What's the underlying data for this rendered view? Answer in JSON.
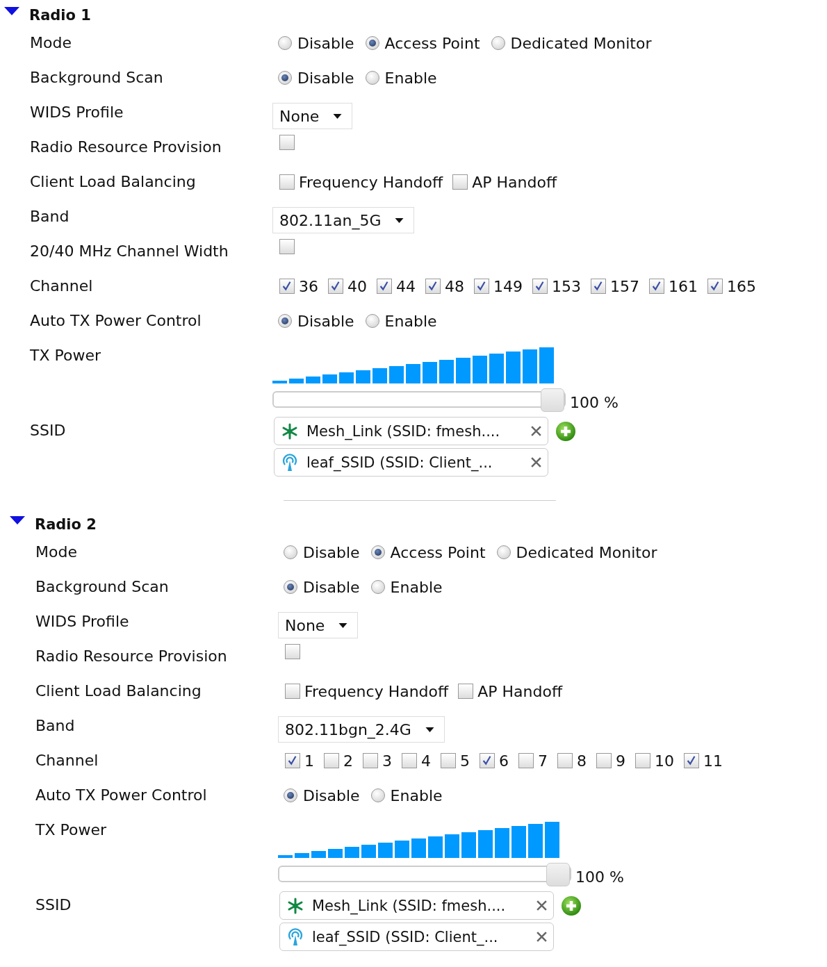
{
  "radios": [
    {
      "title": "Radio 1",
      "expanded": true,
      "rows": [
        {
          "kind": "radio",
          "label": "Mode",
          "options": [
            {
              "label": "Disable",
              "selected": false
            },
            {
              "label": "Access Point",
              "selected": true
            },
            {
              "label": "Dedicated Monitor",
              "selected": false
            }
          ]
        },
        {
          "kind": "radio",
          "label": "Background Scan",
          "options": [
            {
              "label": "Disable",
              "selected": true
            },
            {
              "label": "Enable",
              "selected": false
            }
          ]
        },
        {
          "kind": "select",
          "label": "WIDS Profile",
          "value": "None"
        },
        {
          "kind": "checkbox",
          "label": "Radio Resource Provision",
          "checked": false
        },
        {
          "kind": "checks",
          "label": "Client Load Balancing",
          "options": [
            {
              "label": "Frequency Handoff",
              "checked": false
            },
            {
              "label": "AP Handoff",
              "checked": false
            }
          ]
        },
        {
          "kind": "select",
          "label": "Band",
          "value": "802.11an_5G"
        },
        {
          "kind": "checkbox",
          "label": "20/40 MHz Channel Width",
          "checked": false
        },
        {
          "kind": "checks",
          "label": "Channel",
          "options": [
            {
              "label": "36",
              "checked": true
            },
            {
              "label": "40",
              "checked": true
            },
            {
              "label": "44",
              "checked": true
            },
            {
              "label": "48",
              "checked": true
            },
            {
              "label": "149",
              "checked": true
            },
            {
              "label": "153",
              "checked": true
            },
            {
              "label": "157",
              "checked": true
            },
            {
              "label": "161",
              "checked": true
            },
            {
              "label": "165",
              "checked": true
            }
          ]
        },
        {
          "kind": "radio",
          "label": "Auto TX Power Control",
          "options": [
            {
              "label": "Disable",
              "selected": true
            },
            {
              "label": "Enable",
              "selected": false
            }
          ]
        },
        {
          "kind": "power",
          "label": "TX Power",
          "level": 1,
          "reading": "100 %"
        },
        {
          "kind": "ssid",
          "label": "SSID",
          "items": [
            {
              "kind": "mesh",
              "label": "Mesh_Link (SSID: fmesh...."
            },
            {
              "kind": "leaf",
              "label": "leaf_SSID (SSID: Client_..."
            }
          ]
        }
      ]
    },
    {
      "title": "Radio 2",
      "expanded": true,
      "rows": [
        {
          "kind": "radio",
          "label": "Mode",
          "options": [
            {
              "label": "Disable",
              "selected": false
            },
            {
              "label": "Access Point",
              "selected": true
            },
            {
              "label": "Dedicated Monitor",
              "selected": false
            }
          ]
        },
        {
          "kind": "radio",
          "label": "Background Scan",
          "options": [
            {
              "label": "Disable",
              "selected": true
            },
            {
              "label": "Enable",
              "selected": false
            }
          ]
        },
        {
          "kind": "select",
          "label": "WIDS Profile",
          "value": "None"
        },
        {
          "kind": "checkbox",
          "label": "Radio Resource Provision",
          "checked": false
        },
        {
          "kind": "checks",
          "label": "Client Load Balancing",
          "options": [
            {
              "label": "Frequency Handoff",
              "checked": false
            },
            {
              "label": "AP Handoff",
              "checked": false
            }
          ]
        },
        {
          "kind": "select",
          "label": "Band",
          "value": "802.11bgn_2.4G"
        },
        {
          "kind": "checks",
          "label": "Channel",
          "options": [
            {
              "label": "1",
              "checked": true
            },
            {
              "label": "2",
              "checked": false
            },
            {
              "label": "3",
              "checked": false
            },
            {
              "label": "4",
              "checked": false
            },
            {
              "label": "5",
              "checked": false
            },
            {
              "label": "6",
              "checked": true
            },
            {
              "label": "7",
              "checked": false
            },
            {
              "label": "8",
              "checked": false
            },
            {
              "label": "9",
              "checked": false
            },
            {
              "label": "10",
              "checked": false
            },
            {
              "label": "11",
              "checked": true
            }
          ]
        },
        {
          "kind": "radio",
          "label": "Auto TX Power Control",
          "options": [
            {
              "label": "Disable",
              "selected": true
            },
            {
              "label": "Enable",
              "selected": false
            }
          ]
        },
        {
          "kind": "power",
          "label": "TX Power",
          "level": 1,
          "reading": "100 %"
        },
        {
          "kind": "ssid",
          "label": "SSID",
          "items": [
            {
              "kind": "mesh",
              "label": "Mesh_Link (SSID: fmesh...."
            },
            {
              "kind": "leaf",
              "label": "leaf_SSID (SSID: Client_..."
            }
          ]
        }
      ]
    }
  ]
}
